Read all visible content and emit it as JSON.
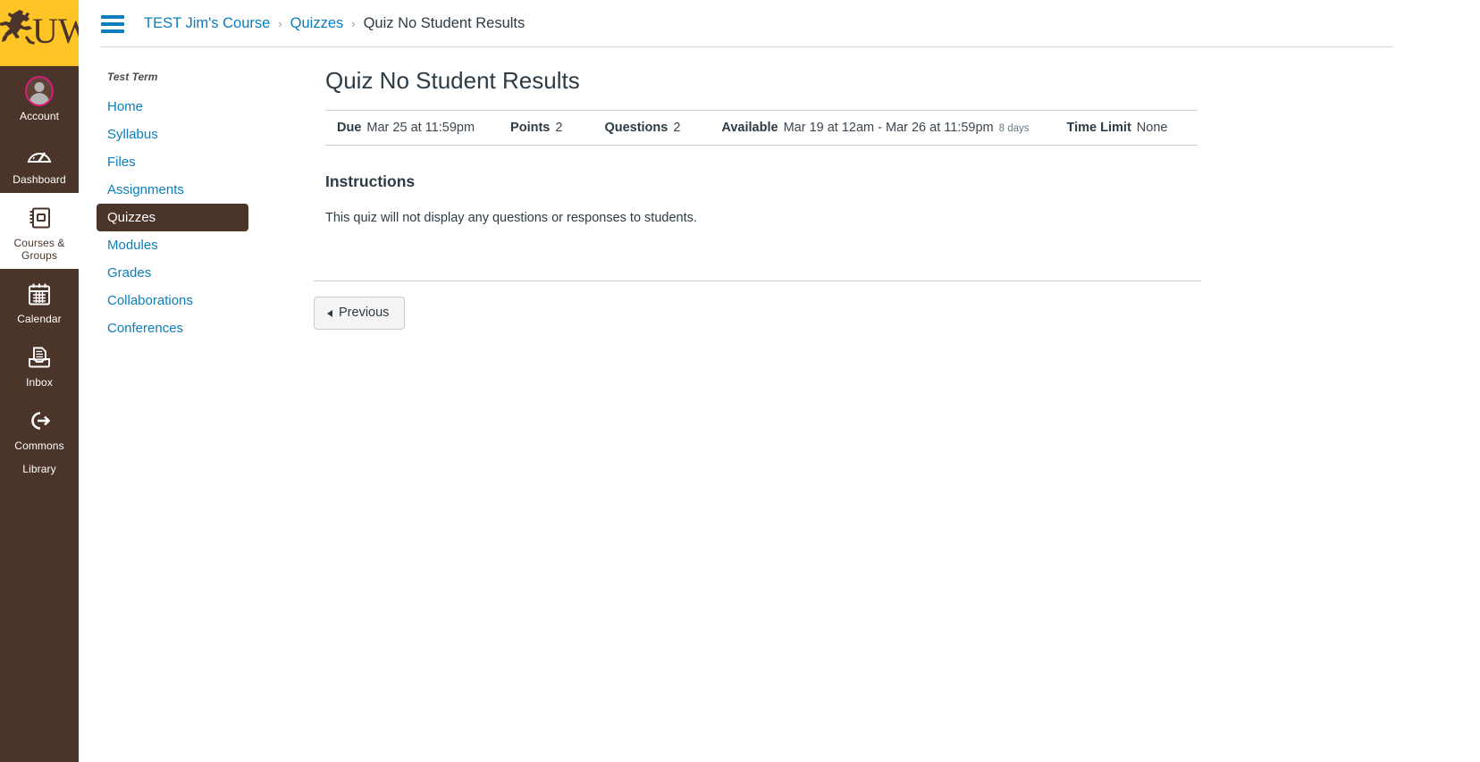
{
  "global_nav": {
    "logo": {
      "name": "uw-logo",
      "text": "UW",
      "bg_color": "#ffc425",
      "fg_color": "#4b342a"
    },
    "items": [
      {
        "label": "Account",
        "icon": "avatar-icon",
        "active": false
      },
      {
        "label": "Dashboard",
        "icon": "dashboard-icon",
        "active": false
      },
      {
        "label": "Courses & Groups",
        "icon": "courses-icon",
        "active": true
      },
      {
        "label": "Calendar",
        "icon": "calendar-icon",
        "active": false
      },
      {
        "label": "Inbox",
        "icon": "inbox-icon",
        "active": false
      },
      {
        "label": "Commons",
        "icon": "commons-icon",
        "active": false
      },
      {
        "label": "Library",
        "icon": "none",
        "active": false
      }
    ],
    "bg_color": "#4b342a",
    "active_bg_color": "#ffffff"
  },
  "header": {
    "menu_icon": "hamburger-menu-icon",
    "breadcrumb": [
      {
        "label": "TEST Jim's Course",
        "link": true
      },
      {
        "label": "Quizzes",
        "link": true
      },
      {
        "label": "Quiz No Student Results",
        "link": false
      }
    ],
    "separator": "›",
    "link_color": "#0a7ebd"
  },
  "course_nav": {
    "term": "Test Term",
    "items": [
      {
        "label": "Home",
        "active": false
      },
      {
        "label": "Syllabus",
        "active": false
      },
      {
        "label": "Files",
        "active": false
      },
      {
        "label": "Assignments",
        "active": false
      },
      {
        "label": "Quizzes",
        "active": true
      },
      {
        "label": "Modules",
        "active": false
      },
      {
        "label": "Grades",
        "active": false
      },
      {
        "label": "Collaborations",
        "active": false
      },
      {
        "label": "Conferences",
        "active": false
      }
    ],
    "active_bg_color": "#4b342a"
  },
  "main": {
    "title": "Quiz No Student Results",
    "details": {
      "due_label": "Due",
      "due_value": "Mar 25 at 11:59pm",
      "points_label": "Points",
      "points_value": "2",
      "questions_label": "Questions",
      "questions_value": "2",
      "available_label": "Available",
      "available_value": "Mar 19 at 12am - Mar 26 at 11:59pm",
      "available_duration": "8 days",
      "time_limit_label": "Time Limit",
      "time_limit_value": "None"
    },
    "instructions_heading": "Instructions",
    "instructions_text": "This quiz will not display any questions or responses to students.",
    "pager": {
      "previous_label": "Previous"
    }
  }
}
